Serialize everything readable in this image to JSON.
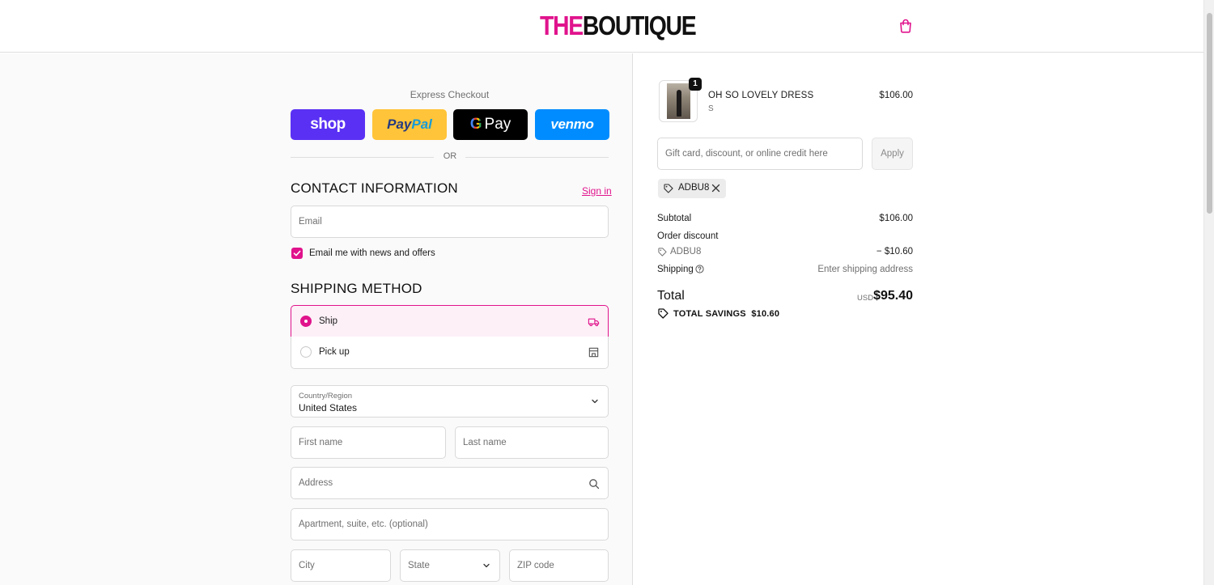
{
  "header": {
    "logo_part1": "THE",
    "logo_part2": "BOUTIQUE"
  },
  "express": {
    "title": "Express Checkout",
    "shop_label": "shop",
    "paypal_label_1": "Pay",
    "paypal_label_2": "Pal",
    "gpay_g": "G",
    "gpay_label": "Pay",
    "venmo_label": "venmo",
    "or_label": "OR"
  },
  "contact": {
    "title": "CONTACT INFORMATION",
    "sign_in": "Sign in",
    "email_placeholder": "Email",
    "newsletter_label": "Email me with news and offers",
    "newsletter_checked": true
  },
  "shipping": {
    "title": "SHIPPING METHOD",
    "options": [
      {
        "label": "Ship",
        "selected": true,
        "icon": "truck-icon"
      },
      {
        "label": "Pick up",
        "selected": false,
        "icon": "store-icon"
      }
    ]
  },
  "address": {
    "country_label": "Country/Region",
    "country_value": "United States",
    "first_name_placeholder": "First name",
    "last_name_placeholder": "Last name",
    "address_placeholder": "Address",
    "apartment_placeholder": "Apartment, suite, etc. (optional)",
    "city_placeholder": "City",
    "state_placeholder": "State",
    "zip_placeholder": "ZIP code"
  },
  "cart": {
    "items": [
      {
        "name": "OH SO LOVELY DRESS",
        "variant": "S",
        "price": "$106.00",
        "quantity": "1"
      }
    ],
    "discount_placeholder": "Gift card, discount, or online credit here",
    "apply_label": "Apply",
    "applied_code": "ADBU8"
  },
  "summary": {
    "subtotal_label": "Subtotal",
    "subtotal_value": "$106.00",
    "order_discount_label": "Order discount",
    "discount_code": "ADBU8",
    "discount_value": "− $10.60",
    "shipping_label": "Shipping",
    "shipping_value": "Enter shipping address",
    "total_label": "Total",
    "currency": "USD",
    "total_value": "$95.40",
    "savings_label": "TOTAL SAVINGS",
    "savings_value": "$10.60"
  },
  "colors": {
    "accent": "#e0138c",
    "shop": "#5a31f4",
    "paypal": "#ffc439",
    "gpay": "#000000",
    "venmo": "#008cff"
  }
}
